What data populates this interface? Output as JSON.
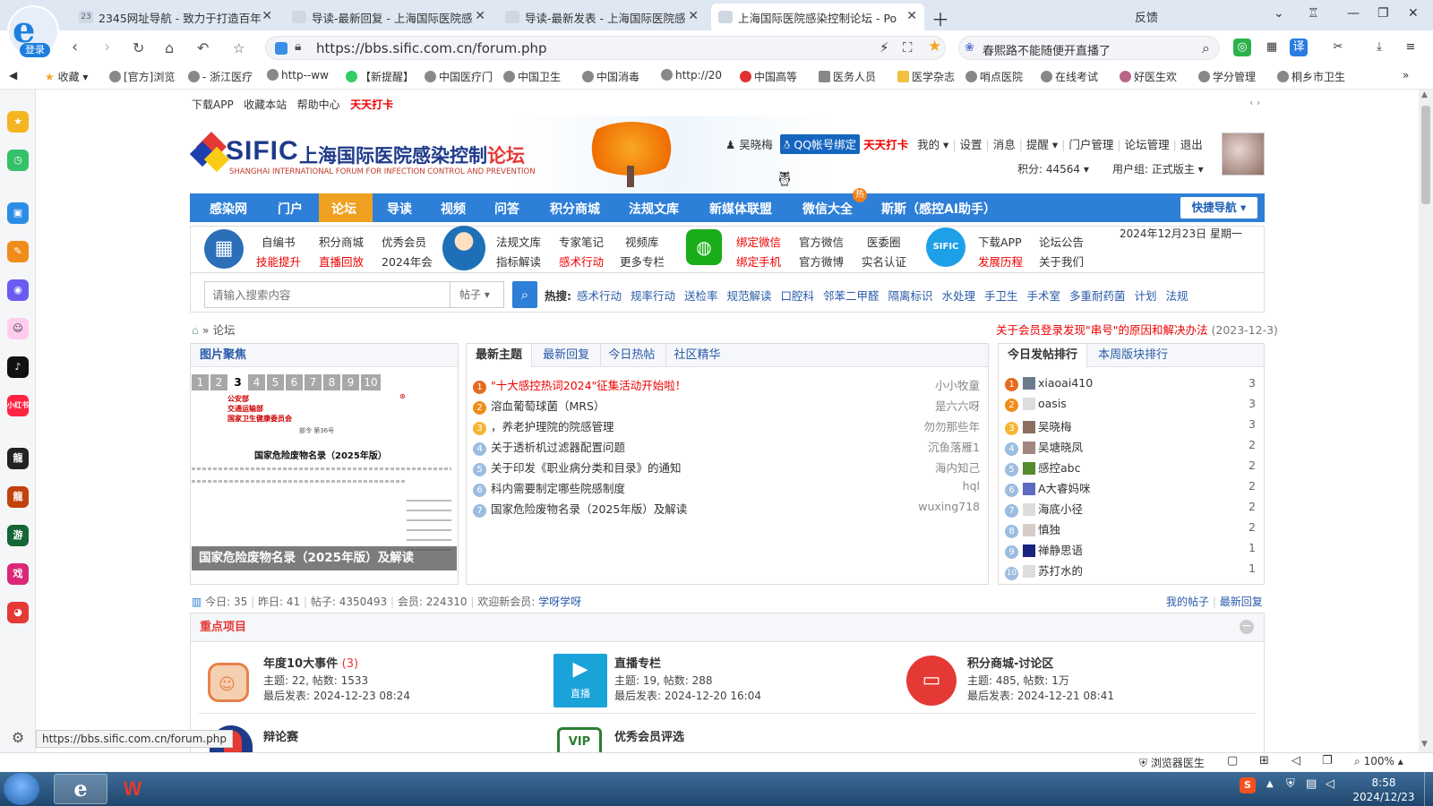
{
  "browser": {
    "tabs": [
      {
        "label": "2345网址导航 - 致力于打造百年",
        "active": false
      },
      {
        "label": "导读-最新回复 - 上海国际医院感",
        "active": false
      },
      {
        "label": "导读-最新发表 - 上海国际医院感",
        "active": false
      },
      {
        "label": "上海国际医院感染控制论坛 - Po",
        "active": true
      }
    ],
    "login_label": "登录",
    "feedback_label": "反馈",
    "url": "https://bbs.sific.com.cn/forum.php",
    "search_value": "春熙路不能随便开直播了",
    "bookmarks": [
      "收藏",
      "[官方]浏览",
      "- 浙江医疗",
      "http--ww",
      "【新提醒】",
      "中国医疗门",
      "中国卫生",
      "中国消毒",
      "http://20",
      "中国高等",
      "医务人员",
      "医学杂志",
      "哨点医院",
      "在线考试",
      "好医生欢",
      "学分管理",
      "桐乡市卫生"
    ],
    "hover_url": "https://bbs.sific.com.cn/forum.php",
    "status_items": {
      "doctor": "浏览器医生",
      "zoom": "100%"
    },
    "taskbar": {
      "time": "8:58",
      "date": "2024/12/23"
    }
  },
  "site": {
    "topbar": [
      "下载APP",
      "收藏本站",
      "帮助中心",
      "天天打卡"
    ],
    "logo_text": "SIFIC",
    "logo_cn": "上海国际医院感染控制",
    "logo_cn_red": "论坛",
    "logo_en": "SHANGHAI INTERNATIONAL FORUM FOR INFECTION CONTROL AND PREVENTION",
    "user": {
      "name": "吴晓梅",
      "qq_bind": "QQ帐号绑定",
      "checkin": "天天打卡",
      "menu": [
        "我的",
        "设置",
        "消息",
        "提醒",
        "门户管理",
        "论坛管理",
        "退出"
      ],
      "points": "积分: 44564",
      "group": "用户组: 正式版主"
    },
    "mainnav": [
      "感染网",
      "门户",
      "论坛",
      "导读",
      "视频",
      "问答",
      "积分商城",
      "法规文库",
      "新媒体联盟",
      "微信大全",
      "斯斯（感控AI助手）"
    ],
    "mainnav_hot_badge": "热",
    "quick_nav_label": "快捷导航",
    "date": "2024年12月23日 星期一",
    "quick_links": [
      {
        "a": "自编书",
        "b": "技能提升"
      },
      {
        "a": "积分商城",
        "b": "直播回放"
      },
      {
        "a": "优秀会员",
        "b": "2024年会"
      },
      {
        "a": "法规文库",
        "b": "指标解读"
      },
      {
        "a": "专家笔记",
        "b": "感术行动"
      },
      {
        "a": "视频库",
        "b": "更多专栏"
      },
      {
        "a": "绑定微信",
        "b": "绑定手机"
      },
      {
        "a": "官方微信",
        "b": "官方微博"
      },
      {
        "a": "医委圈",
        "b": "实名认证"
      },
      {
        "a": "下载APP",
        "b": "发展历程"
      },
      {
        "a": "论坛公告",
        "b": "关于我们"
      }
    ],
    "search": {
      "placeholder": "请输入搜索内容",
      "type": "帖子",
      "hot_label": "热搜:",
      "hot": [
        "感术行动",
        "规率行动",
        "送检率",
        "规范解读",
        "口腔科",
        "邻苯二甲醛",
        "隔离标识",
        "水处理",
        "手卫生",
        "手术室",
        "多重耐药菌",
        "计划",
        "法规"
      ]
    },
    "breadcrumb": "论坛",
    "notice": "关于会员登录发现\"串号\"的原因和解决办法",
    "notice_date": "(2023-12-3)"
  },
  "focus": {
    "title": "图片聚焦",
    "pager": [
      "1",
      "2",
      "3",
      "4",
      "5",
      "6",
      "7",
      "8",
      "9",
      "10"
    ],
    "active_page": "3",
    "doc_lines": [
      "公安部",
      "交通运输部",
      "国家卫生健康委员会"
    ],
    "doc_number": "部令 第36号",
    "doc_heading": "国家危险废物名录（2025年版）",
    "caption": "国家危险废物名录（2025年版）及解读"
  },
  "threads": {
    "tabs": [
      "最新主题",
      "最新回复",
      "今日热帖",
      "社区精华"
    ],
    "items": [
      {
        "title": "\"十大感控热词2024\"征集活动开始啦！",
        "author": "小小牧童",
        "red": true
      },
      {
        "title": "溶血葡萄球菌（MRS）",
        "author": "是六六呀"
      },
      {
        "title": "，养老护理院的院感管理",
        "author": "勿勿那些年"
      },
      {
        "title": "关于透析机过滤器配置问题",
        "author": "沉鱼落雁1"
      },
      {
        "title": "关于印发《职业病分类和目录》的通知",
        "author": "海内知己"
      },
      {
        "title": "科内需要制定哪些院感制度",
        "author": "hql"
      },
      {
        "title": "国家危险废物名录（2025年版）及解读",
        "author": "wuxing718"
      }
    ]
  },
  "rank": {
    "tabs": [
      "今日发帖排行",
      "本周版块排行"
    ],
    "items": [
      {
        "name": "xiaoai410",
        "count": "3"
      },
      {
        "name": "oasis",
        "count": "3"
      },
      {
        "name": "吴晓梅",
        "count": "3"
      },
      {
        "name": "吴塘晓凤",
        "count": "2"
      },
      {
        "name": "感控abc",
        "count": "2"
      },
      {
        "name": "A大睿妈咪",
        "count": "2"
      },
      {
        "name": "海底小径",
        "count": "2"
      },
      {
        "name": "慎独",
        "count": "2"
      },
      {
        "name": "禅静思语",
        "count": "1"
      },
      {
        "name": "苏打水的",
        "count": "1"
      }
    ]
  },
  "stats": {
    "today": "今日: 35",
    "yesterday": "昨日: 41",
    "posts": "帖子: 4350493",
    "members": "会员: 224310",
    "welcome": "欢迎新会员:",
    "new_member": "学呀学呀",
    "my_posts": "我的帖子",
    "latest": "最新回复"
  },
  "key_projects": {
    "title": "重点项目",
    "items": [
      {
        "name": "年度10大事件",
        "extra": "(3)",
        "l1": "主题: 22, 帖数: 1533",
        "l2": "最后发表: 2024-12-23 08:24"
      },
      {
        "name": "直播专栏",
        "extra": "",
        "l1": "主题: 19, 帖数: 288",
        "l2": "最后发表: 2024-12-20 16:04"
      },
      {
        "name": "积分商城-讨论区",
        "extra": "",
        "l1": "主题: 485, 帖数: 1万",
        "l2": "最后发表: 2024-12-21 08:41"
      },
      {
        "name": "辩论赛",
        "extra": "",
        "l1": "",
        "l2": ""
      },
      {
        "name": "优秀会员评选",
        "extra": "",
        "l1": "",
        "l2": ""
      }
    ],
    "live_label": "直播",
    "vip_label": "VIP"
  }
}
